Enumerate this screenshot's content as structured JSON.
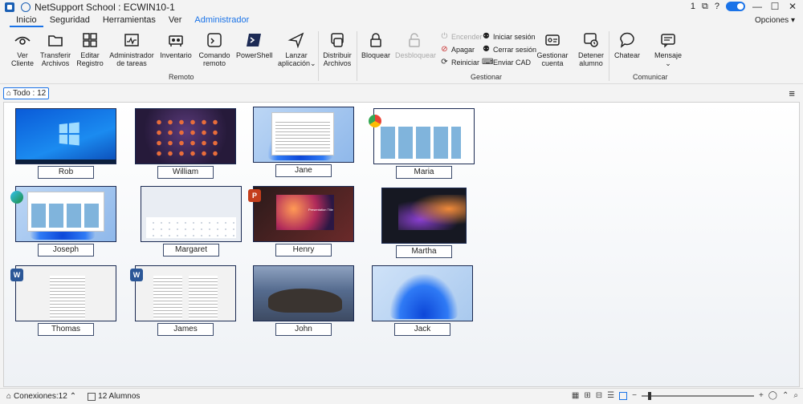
{
  "window": {
    "title": "NetSupport School : ECWIN10-1",
    "badge_count": "1",
    "help": "?",
    "options_label": "Opciones"
  },
  "menu": {
    "tabs": [
      "Inicio",
      "Seguridad",
      "Herramientas",
      "Ver",
      "Administrador"
    ]
  },
  "ribbon": {
    "remote": {
      "label": "Remoto",
      "buttons": [
        {
          "l1": "Ver",
          "l2": "Cliente",
          "icon": "eye-icon"
        },
        {
          "l1": "Transferir",
          "l2": "Archivos",
          "icon": "folder-icon"
        },
        {
          "l1": "Editar",
          "l2": "Registro",
          "icon": "registry-icon"
        },
        {
          "l1": "Administrador",
          "l2": "de tareas",
          "icon": "task-manager-icon"
        },
        {
          "l1": "Inventario",
          "l2": "",
          "icon": "inventory-icon"
        },
        {
          "l1": "Comando",
          "l2": "remoto",
          "icon": "terminal-icon"
        },
        {
          "l1": "PowerShell",
          "l2": "",
          "icon": "powershell-icon"
        },
        {
          "l1": "Lanzar",
          "l2": "aplicación",
          "icon": "launch-icon"
        },
        {
          "l1": "Distribuir",
          "l2": "Archivos",
          "icon": "distribute-icon"
        }
      ]
    },
    "manage": {
      "label": "Gestionar",
      "lock": "Bloquear",
      "unlock": "Desbloquear",
      "power_on": "Encender",
      "power_off": "Apagar",
      "restart": "Reiniciar",
      "login": "Iniciar sesión",
      "logout": "Cerrar sesión",
      "send_cad": "Enviar CAD",
      "account_l1": "Gestionar",
      "account_l2": "cuenta",
      "stop_l1": "Detener",
      "stop_l2": "alumno"
    },
    "communicate": {
      "label": "Comunicar",
      "chat": "Chatear",
      "message": "Mensaje"
    }
  },
  "subbar": {
    "all_label": "Todo : 12"
  },
  "students": [
    {
      "name": "Rob",
      "screen": "win10",
      "app": ""
    },
    {
      "name": "William",
      "screen": "android",
      "app": ""
    },
    {
      "name": "Jane",
      "screen": "win11-explorer",
      "app": "explorer"
    },
    {
      "name": "Maria",
      "screen": "browser",
      "app": "chrome"
    },
    {
      "name": "Joseph",
      "screen": "edge",
      "app": "edge"
    },
    {
      "name": "Margaret",
      "screen": "tablet",
      "app": ""
    },
    {
      "name": "Henry",
      "screen": "powerpoint",
      "app": "powerpoint"
    },
    {
      "name": "Martha",
      "screen": "dark-phone",
      "app": ""
    },
    {
      "name": "Thomas",
      "screen": "word",
      "app": "word"
    },
    {
      "name": "James",
      "screen": "word",
      "app": "word"
    },
    {
      "name": "John",
      "screen": "macos",
      "app": ""
    },
    {
      "name": "Jack",
      "screen": "win11",
      "app": ""
    }
  ],
  "ppt_slide_title": "Presentation Title",
  "status": {
    "connections": "Conexiones:12",
    "students": "12 Alumnos",
    "zoom_min": "−",
    "zoom_max": "+"
  },
  "colors": {
    "accent": "#1a73e8",
    "thumb_border": "#1b2a52"
  }
}
